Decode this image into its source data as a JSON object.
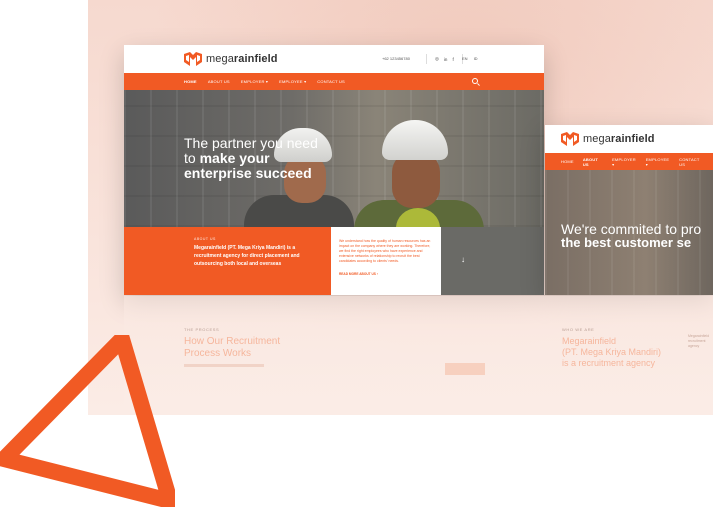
{
  "brand": {
    "name_plain": "mega",
    "name_bold": "rainfield",
    "color": "#f15a24"
  },
  "main_site": {
    "phone": "+62 123456780",
    "social": [
      "◎",
      "in",
      "f"
    ],
    "languages": [
      "EN",
      "ID"
    ],
    "nav": [
      {
        "label": "HOME",
        "active": true
      },
      {
        "label": "ABOUT US",
        "active": false
      },
      {
        "label": "EMPLOYER ▾",
        "active": false
      },
      {
        "label": "EMPLOYEE ▾",
        "active": false
      },
      {
        "label": "CONTACT US",
        "active": false
      }
    ],
    "hero": {
      "line1": "The partner you need",
      "line2_prefix": "to ",
      "line2_bold": "make your",
      "line3": "enterprise succeed"
    },
    "about": {
      "tag": "ABOUT US",
      "text": "Megarainfield (PT. Mega Kriya Mandiri) is a recruitment agency for direct placement and outsourcing both local and overseas",
      "detail": "We understand how the quality of human resources has an impact on the company where they are working. Therefore, we find the right employees who have experience and extensive networks of relationship to recruit the best candidates according to clients' needs.",
      "read_more": "READ MORE ABOUT US ›"
    },
    "process": {
      "tag": "THE PROCESS",
      "title_line1": "How Our Recruitment",
      "title_line2": "Process Works"
    }
  },
  "second_site": {
    "nav": [
      {
        "label": "HOME",
        "active": false
      },
      {
        "label": "ABOUT US",
        "active": true
      },
      {
        "label": "EMPLOYER ▾",
        "active": false
      },
      {
        "label": "EMPLOYEE ▾",
        "active": false
      },
      {
        "label": "CONTACT US",
        "active": false
      }
    ],
    "hero": {
      "line1": "We're commited to pro",
      "line2": "the best customer se"
    },
    "who": {
      "tag": "WHO WE ARE",
      "title_line1": "Megarainfield",
      "title_line2": "(PT. Mega Kriya Mandiri)",
      "title_line3": "is a recruitment agency",
      "side": "Megarainfield recruitment agency"
    }
  }
}
